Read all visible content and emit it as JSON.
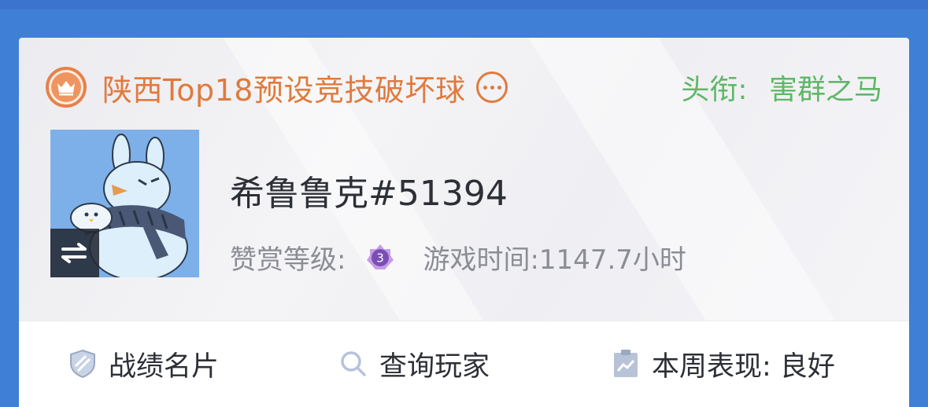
{
  "rank": {
    "label": "陕西Top18预设竞技破坏球",
    "icon": "crown-icon",
    "more_icon": "more-options-icon"
  },
  "title": {
    "prefix": "头衔:",
    "value": "害群之马"
  },
  "player": {
    "name": "希鲁鲁克#51394",
    "avatar_icon": "rabbit-avatar",
    "swap_icon": "swap-arrows-icon"
  },
  "stats": {
    "appreciation_label": "赞赏等级:",
    "appreciation_level": "3",
    "playtime": "游戏时间:1147.7小时"
  },
  "actions": [
    {
      "label": "战绩名片",
      "icon": "shield-icon"
    },
    {
      "label": "查询玩家",
      "icon": "search-icon"
    },
    {
      "label": "本周表现: 良好",
      "icon": "clipboard-chart-icon"
    }
  ],
  "colors": {
    "accent_orange": "#e07a3e",
    "title_green": "#5fb767",
    "background_blue": "#3f7fd6",
    "level_purple": "#b07ad8"
  }
}
